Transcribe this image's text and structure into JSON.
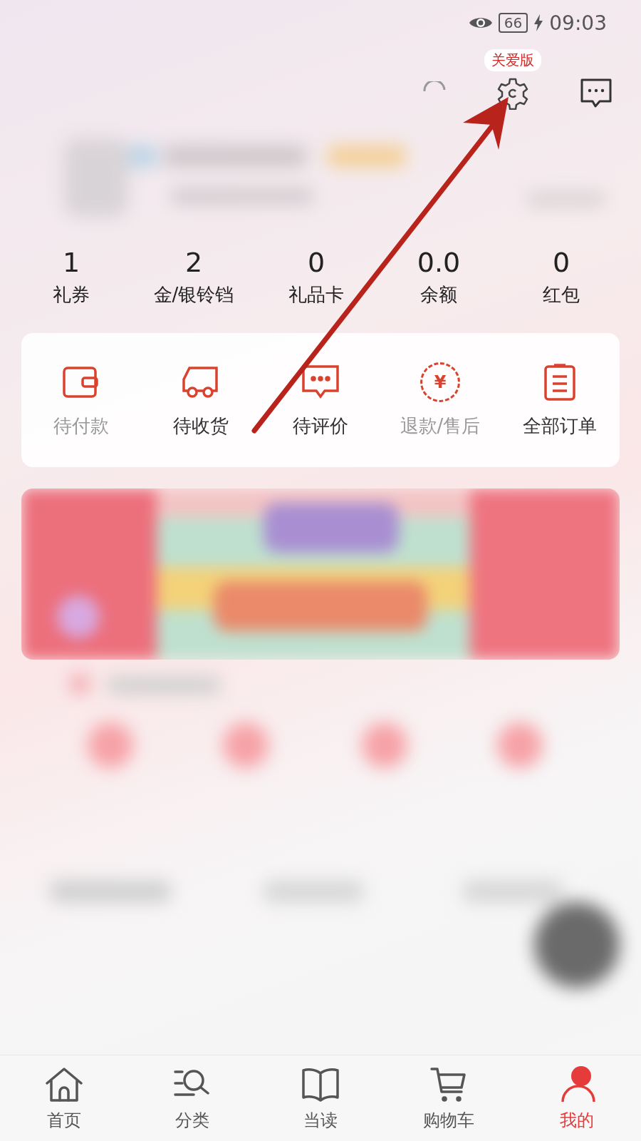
{
  "status_bar": {
    "battery": "66",
    "time": "09:03"
  },
  "care_badge": "关爱版",
  "stats": [
    {
      "value": "1",
      "label": "礼券"
    },
    {
      "value": "2",
      "label": "金/银铃铛"
    },
    {
      "value": "0",
      "label": "礼品卡"
    },
    {
      "value": "0.0",
      "label": "余额"
    },
    {
      "value": "0",
      "label": "红包"
    }
  ],
  "orders": [
    {
      "kind": "wallet",
      "label": "待付款"
    },
    {
      "kind": "truck",
      "label": "待收货"
    },
    {
      "kind": "comment",
      "label": "待评价"
    },
    {
      "kind": "refund",
      "label": "退款/售后",
      "symbol": "¥"
    },
    {
      "kind": "list",
      "label": "全部订单"
    }
  ],
  "tab_bar": [
    {
      "kind": "home",
      "label": "首页",
      "selected": false
    },
    {
      "kind": "category",
      "label": "分类",
      "selected": false
    },
    {
      "kind": "book",
      "label": "当读",
      "selected": false
    },
    {
      "kind": "cart",
      "label": "购物车",
      "selected": false
    },
    {
      "kind": "me",
      "label": "我的",
      "selected": true
    }
  ]
}
